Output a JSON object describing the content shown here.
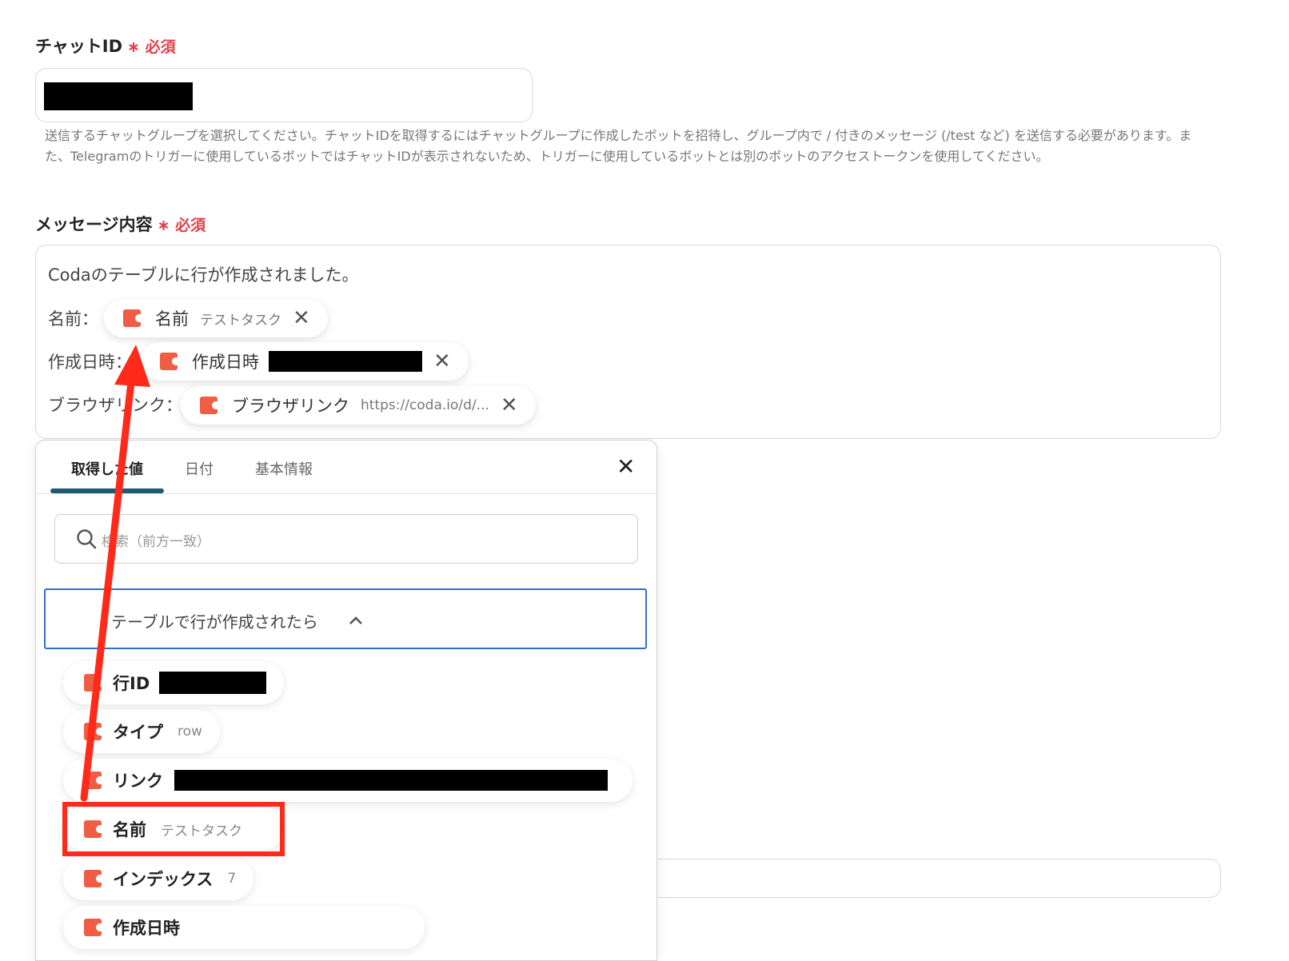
{
  "chat_id": {
    "label": "チャットID",
    "required": "∗ 必須",
    "help_line1": "送信するチャットグループを選択してください。チャットIDを取得するにはチャットグループに作成したボットを招待し、グループ内で / 付きのメッセージ (/test など) を送信する必要があります。ま",
    "help_line2": "た、Telegramのトリガーに使用しているボットではチャットIDが表示されないため、トリガーに使用しているボットとは別のボットのアクセストークンを使用してください。"
  },
  "message": {
    "label": "メッセージ内容",
    "required": "∗ 必須",
    "line1": "Codaのテーブルに行が作成されました。",
    "name_label": "名前：",
    "created_label": "作成日時：",
    "browser_label": "ブラウザリンク：",
    "chips": [
      {
        "name": "名前",
        "value": "テストタスク"
      },
      {
        "name": "作成日時",
        "value": ""
      },
      {
        "name": "ブラウザリンク",
        "value": "https://coda.io/d/..."
      }
    ],
    "remove_glyph": "✕"
  },
  "picker": {
    "tabs": [
      "取得した値",
      "日付",
      "基本情報"
    ],
    "close_glyph": "✕",
    "search_placeholder": "検索（前方一致）",
    "group_title": "テーブルで行が作成されたら",
    "items": [
      {
        "name": "行ID",
        "value": ""
      },
      {
        "name": "タイプ",
        "value": "row"
      },
      {
        "name": "リンク",
        "value": ""
      },
      {
        "name": "名前",
        "value": "テストタスク"
      },
      {
        "name": "インデックス",
        "value": "7"
      },
      {
        "name": "作成日時",
        "value": ""
      }
    ]
  },
  "colors": {
    "accent": "#ef5d44",
    "annotation": "#ff2a1a",
    "tab_underline": "#1d5a73",
    "group_border": "#2f6fd0"
  }
}
